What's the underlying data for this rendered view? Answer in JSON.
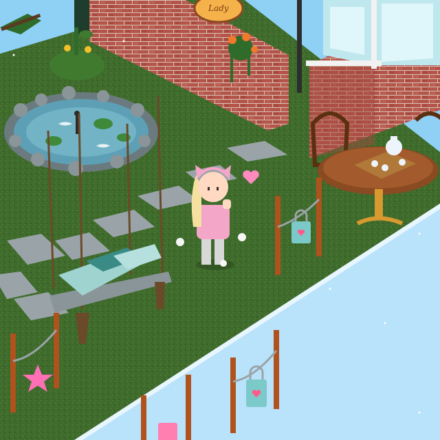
{
  "scene": {
    "type": "isometric-room",
    "theme": "garden cafe terrace",
    "sign": {
      "text": "Lady",
      "icon": "cafe-sign-icon"
    },
    "colors": {
      "sky": "#8fd0f5",
      "snow_floor": "#b9e2fb",
      "grass": "#3f6b2c",
      "grass_dark": "#2f5420",
      "brick": "#b4544a",
      "brick_mortar": "#d7c6b5",
      "pond_water": "#5d9fb4",
      "stone": "#9aa4a8",
      "wood": "#8a4a22",
      "heart_pink": "#ff7fb0",
      "padlock_teal": "#7cc9c9"
    },
    "objects": [
      {
        "name": "cafe-building",
        "icon": "brick-wall-icon"
      },
      {
        "name": "koi-pond",
        "icon": "pond-icon"
      },
      {
        "name": "stepping-stones",
        "icon": "stone-icon"
      },
      {
        "name": "hanging-swing-bed",
        "icon": "swing-icon"
      },
      {
        "name": "cafe-table",
        "icon": "table-icon"
      },
      {
        "name": "tea-set",
        "icon": "teapot-icon"
      },
      {
        "name": "love-lock-fence",
        "icon": "padlock-heart-icon"
      },
      {
        "name": "avatar",
        "icon": "avatar-icon",
        "status": "heart-bubble"
      }
    ]
  }
}
